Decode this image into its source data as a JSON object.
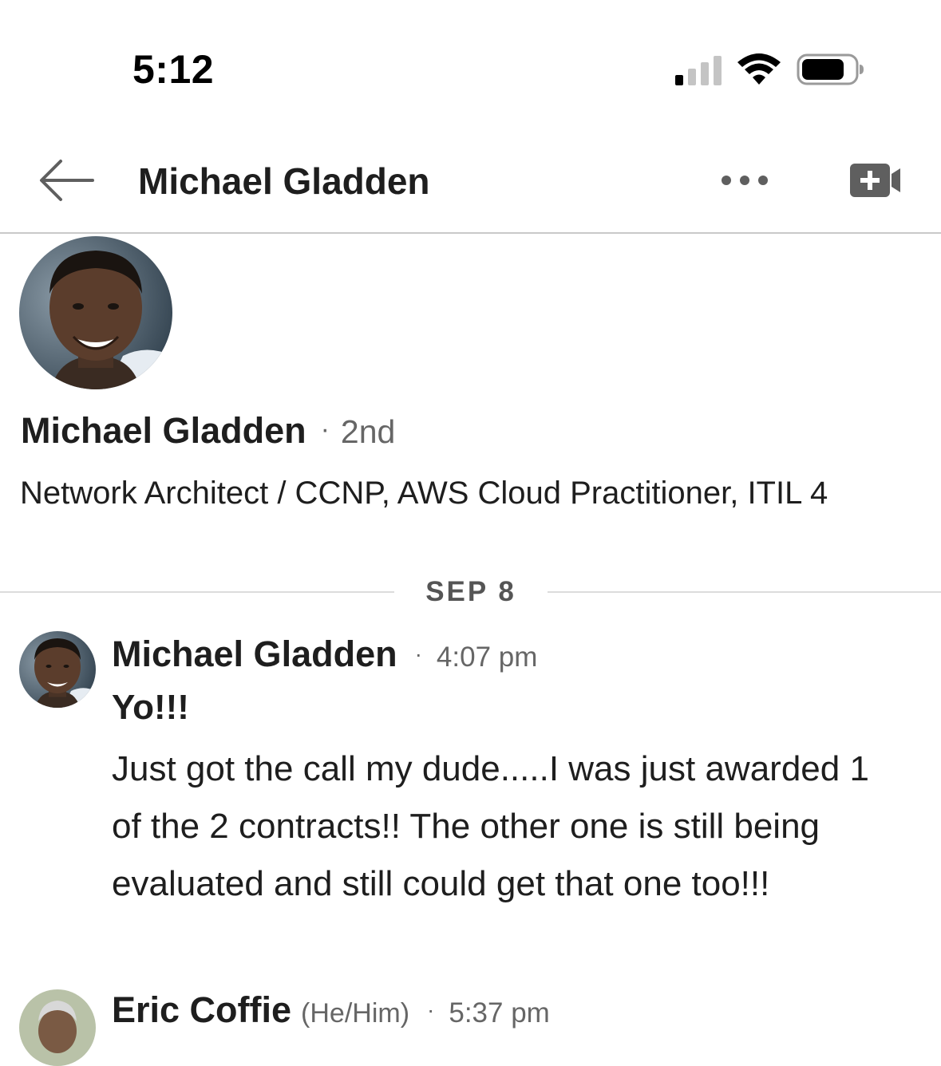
{
  "status_bar": {
    "time": "5:12"
  },
  "nav": {
    "title": "Michael Gladden"
  },
  "profile": {
    "name": "Michael Gladden",
    "degree": "2nd",
    "headline": "Network Architect / CCNP, AWS Cloud Practitioner, ITIL 4"
  },
  "divider": {
    "date": "SEP 8"
  },
  "messages": [
    {
      "sender": "Michael Gladden",
      "time": "4:07 pm",
      "greeting": "Yo!!!",
      "body": "Just got the call my dude.....I was just awarded 1 of the 2 contracts!! The other one is still being evaluated and still could get that one too!!!"
    },
    {
      "sender": "Eric Coffie",
      "pronouns": "(He/Him)",
      "time": "5:37 pm"
    }
  ],
  "separator": "·",
  "colors": {
    "text_primary": "#1e1e1e",
    "text_secondary": "#666666",
    "divider": "#c9c9c9",
    "icon_gray": "#5f5f5f"
  },
  "icons": {
    "back": "arrow-left-icon",
    "more": "more-horizontal-icon",
    "video": "video-call-icon",
    "signal": "cellular-signal-icon",
    "wifi": "wifi-icon",
    "battery": "battery-icon"
  }
}
